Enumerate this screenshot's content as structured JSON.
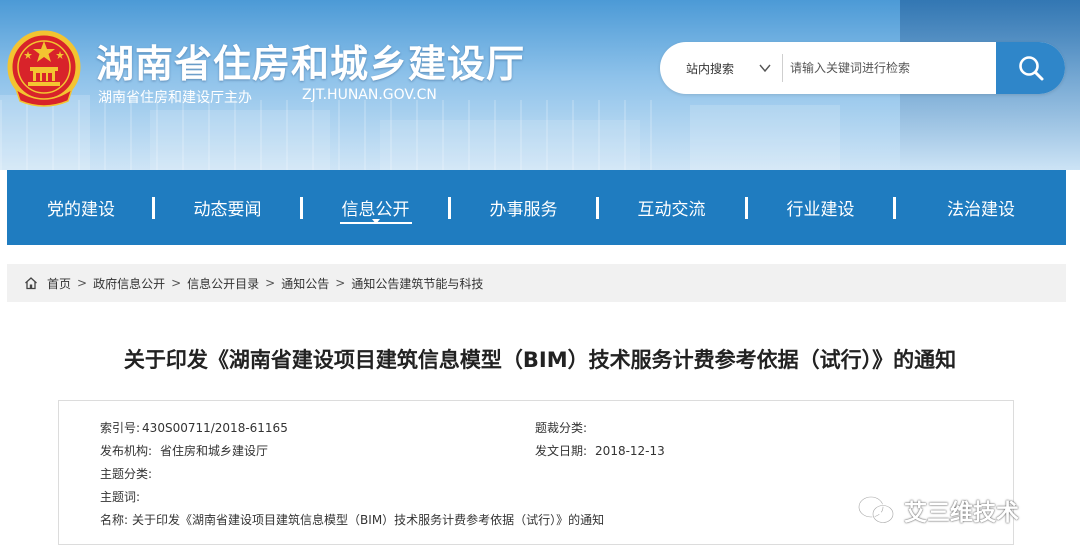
{
  "header": {
    "title": "湖南省住房和城乡建设厅",
    "subtitle": "湖南省住房和建设厅主办",
    "domain": "ZJT.HUNAN.GOV.CN",
    "emblem_icon": "national-emblem-icon"
  },
  "search": {
    "scope_label": "站内搜索",
    "placeholder": "请输入关键词进行检索",
    "button_icon": "search-icon"
  },
  "nav": {
    "items": [
      {
        "label": "党的建设"
      },
      {
        "label": "动态要闻"
      },
      {
        "label": "信息公开",
        "active": true
      },
      {
        "label": "办事服务"
      },
      {
        "label": "互动交流"
      },
      {
        "label": "行业建设"
      },
      {
        "label": "法治建设"
      }
    ],
    "background": "#1f7cc0"
  },
  "breadcrumb": {
    "home_icon": "home-icon",
    "items": [
      "首页",
      "政府信息公开",
      "信息公开目录",
      "通知公告",
      "通知公告建筑节能与科技"
    ],
    "separator": ">"
  },
  "article": {
    "title": "关于印发《湖南省建设项目建筑信息模型（BIM）技术服务计费参考依据（试行）》的通知"
  },
  "meta": {
    "index_label": "索引号:",
    "index_value": "430S00711/2018-61165",
    "category_label": "题裁分类:",
    "category_value": "",
    "publisher_label": "发布机构:",
    "publisher_value": "省住房和城乡建设厅",
    "date_label": "发文日期:",
    "date_value": "2018-12-13",
    "topic_label": "主题分类:",
    "topic_value": "",
    "keywords_label": "主题词:",
    "keywords_value": "",
    "name_label": "名称:",
    "name_value": "关于印发《湖南省建设项目建筑信息模型（BIM）技术服务计费参考依据（试行）》的通知"
  },
  "watermark": {
    "text": "艾三维技术",
    "icon": "wechat-icon"
  }
}
